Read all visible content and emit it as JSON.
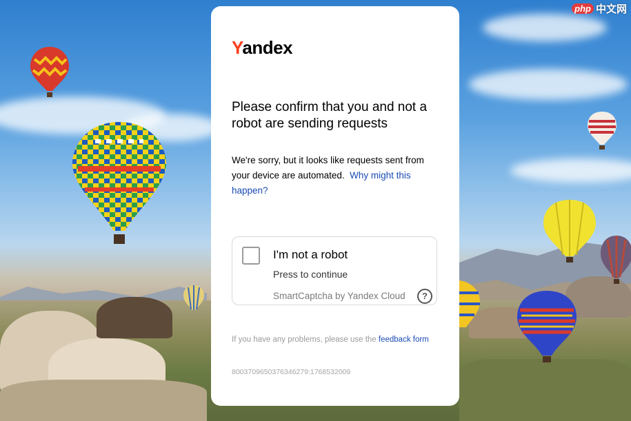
{
  "watermark": {
    "badge": "php",
    "text": "中文网"
  },
  "brand": {
    "logo_first": "Y",
    "logo_rest": "andex",
    "accent_color": "#fc3f1d"
  },
  "heading": "Please confirm that you and not a robot are sending requests",
  "description": {
    "text": "We're sorry, but it looks like requests sent from your device are automated.",
    "link": "Why might this happen?"
  },
  "captcha": {
    "title": "I'm not a robot",
    "subtitle": "Press to continue",
    "brand": "SmartCaptcha by Yandex Cloud",
    "help_icon": "question-circle-icon",
    "help_glyph": "?"
  },
  "footer": {
    "text": "If you have any problems, please use the",
    "link": "feedback form"
  },
  "request_id": "8003709650376346279:1768532009"
}
